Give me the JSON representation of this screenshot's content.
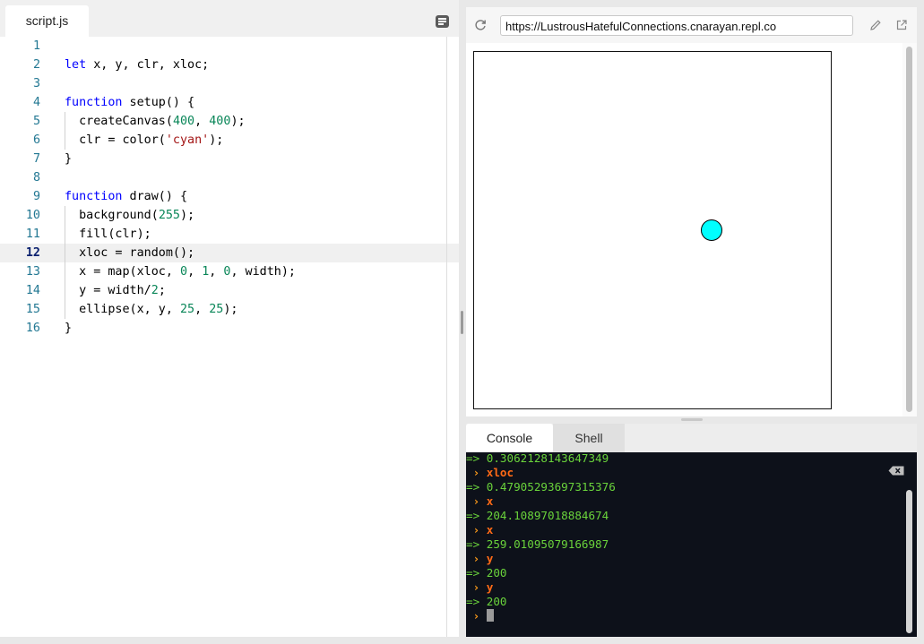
{
  "editor": {
    "tab_label": "script.js",
    "menu_icon": "editor-menu-icon",
    "lines": [
      {
        "n": "1",
        "tokens": []
      },
      {
        "n": "2",
        "tokens": [
          {
            "t": "let",
            "c": "kw"
          },
          {
            "t": " x, y, clr, xloc;"
          }
        ]
      },
      {
        "n": "3",
        "tokens": []
      },
      {
        "n": "4",
        "tokens": [
          {
            "t": "function",
            "c": "kw"
          },
          {
            "t": " setup() {"
          }
        ]
      },
      {
        "n": "5",
        "indent": true,
        "tokens": [
          {
            "t": "  createCanvas("
          },
          {
            "t": "400",
            "c": "num"
          },
          {
            "t": ", "
          },
          {
            "t": "400",
            "c": "num"
          },
          {
            "t": ");"
          }
        ]
      },
      {
        "n": "6",
        "indent": true,
        "tokens": [
          {
            "t": "  clr = color("
          },
          {
            "t": "'cyan'",
            "c": "str"
          },
          {
            "t": ");"
          }
        ]
      },
      {
        "n": "7",
        "tokens": [
          {
            "t": "}"
          }
        ]
      },
      {
        "n": "8",
        "tokens": []
      },
      {
        "n": "9",
        "tokens": [
          {
            "t": "function",
            "c": "kw"
          },
          {
            "t": " draw() {"
          }
        ]
      },
      {
        "n": "10",
        "indent": true,
        "tokens": [
          {
            "t": "  background("
          },
          {
            "t": "255",
            "c": "num"
          },
          {
            "t": ");"
          }
        ]
      },
      {
        "n": "11",
        "indent": true,
        "tokens": [
          {
            "t": "  fill(clr);"
          }
        ]
      },
      {
        "n": "12",
        "indent": true,
        "active": true,
        "tokens": [
          {
            "t": "  xloc = random();"
          }
        ]
      },
      {
        "n": "13",
        "indent": true,
        "tokens": [
          {
            "t": "  x = map(xloc, "
          },
          {
            "t": "0",
            "c": "num"
          },
          {
            "t": ", "
          },
          {
            "t": "1",
            "c": "num"
          },
          {
            "t": ", "
          },
          {
            "t": "0",
            "c": "num"
          },
          {
            "t": ", width);"
          }
        ]
      },
      {
        "n": "14",
        "indent": true,
        "tokens": [
          {
            "t": "  y = width/"
          },
          {
            "t": "2",
            "c": "num"
          },
          {
            "t": ";"
          }
        ]
      },
      {
        "n": "15",
        "indent": true,
        "tokens": [
          {
            "t": "  ellipse(x, y, "
          },
          {
            "t": "25",
            "c": "num"
          },
          {
            "t": ", "
          },
          {
            "t": "25",
            "c": "num"
          },
          {
            "t": ");"
          }
        ]
      },
      {
        "n": "16",
        "tokens": [
          {
            "t": "}"
          }
        ]
      }
    ]
  },
  "preview": {
    "url": "https://LustrousHatefulConnections.cnarayan.repl.co",
    "reload_icon": "reload-icon",
    "edit_icon": "pencil-icon",
    "open_icon": "open-in-new-tab-icon",
    "ellipse_color": "#00ffff"
  },
  "console": {
    "tabs": [
      "Console",
      "Shell"
    ],
    "active_tab": "Console",
    "clear_icon": "clear-console-icon",
    "lines": [
      {
        "kind": "out",
        "text": "=> 0.3062128143647349"
      },
      {
        "kind": "in",
        "text": "xloc"
      },
      {
        "kind": "out",
        "text": "=> 0.47905293697315376"
      },
      {
        "kind": "in",
        "text": "x"
      },
      {
        "kind": "out",
        "text": "=> 204.10897018884674"
      },
      {
        "kind": "in",
        "text": "x"
      },
      {
        "kind": "out",
        "text": "=> 259.01095079166987"
      },
      {
        "kind": "in",
        "text": "y"
      },
      {
        "kind": "out",
        "text": "=> 200"
      },
      {
        "kind": "in",
        "text": "y"
      },
      {
        "kind": "out",
        "text": "=> 200"
      }
    ],
    "colors": {
      "output": "#6ad33b",
      "input": "#ff6a16",
      "background": "#0d111a"
    }
  }
}
